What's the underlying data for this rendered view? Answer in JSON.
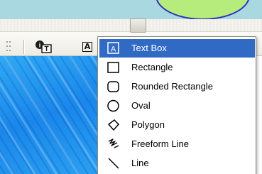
{
  "toolbar": {
    "buttons": [
      {
        "icon": "textbox-insert-icon"
      },
      {
        "icon": "draw-text-icon"
      }
    ]
  },
  "menu": {
    "items": [
      {
        "label": "Text Box",
        "icon": "text-box-icon",
        "selected": true
      },
      {
        "label": "Rectangle",
        "icon": "rectangle-icon"
      },
      {
        "label": "Rounded Rectangle",
        "icon": "rounded-rectangle-icon"
      },
      {
        "label": "Oval",
        "icon": "oval-icon"
      },
      {
        "label": "Polygon",
        "icon": "polygon-icon"
      },
      {
        "label": "Freeform Line",
        "icon": "freeform-line-icon"
      },
      {
        "label": "Line",
        "icon": "line-icon"
      }
    ]
  },
  "colors": {
    "menu_highlight": "#316ac5",
    "canvas_blue": "#1a87ea",
    "shape_fill_green": "#b6ec7c",
    "shape_border_blue": "#2d2fbe"
  }
}
